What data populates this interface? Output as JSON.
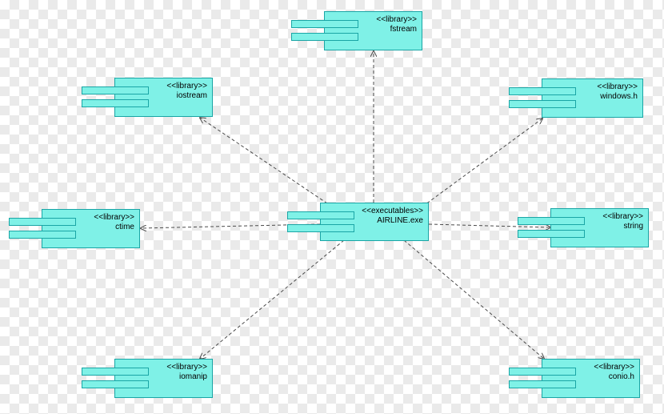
{
  "diagram": {
    "type": "uml-component-diagram",
    "central": {
      "stereo": "<<executables>>",
      "name": "AIRLINE.exe"
    },
    "libs": {
      "fstream": {
        "stereo": "<<library>>",
        "name": "fstream"
      },
      "iostream": {
        "stereo": "<<library>>",
        "name": "iostream"
      },
      "windowsh": {
        "stereo": "<<library>>",
        "name": "windows.h"
      },
      "ctime": {
        "stereo": "<<library>>",
        "name": "ctime"
      },
      "string": {
        "stereo": "<<library>>",
        "name": "string"
      },
      "iomanip": {
        "stereo": "<<library>>",
        "name": "iomanip"
      },
      "conioh": {
        "stereo": "<<library>>",
        "name": "conio.h"
      }
    },
    "edges": [
      {
        "from": "central",
        "to": "fstream"
      },
      {
        "from": "central",
        "to": "iostream"
      },
      {
        "from": "central",
        "to": "windowsh"
      },
      {
        "from": "central",
        "to": "ctime"
      },
      {
        "from": "central",
        "to": "string"
      },
      {
        "from": "central",
        "to": "iomanip"
      },
      {
        "from": "central",
        "to": "conioh"
      }
    ],
    "style": {
      "component_fill": "#7ff1e7",
      "component_stroke": "#1aa5a5",
      "arrow_stroke": "#4a4a4a"
    }
  }
}
